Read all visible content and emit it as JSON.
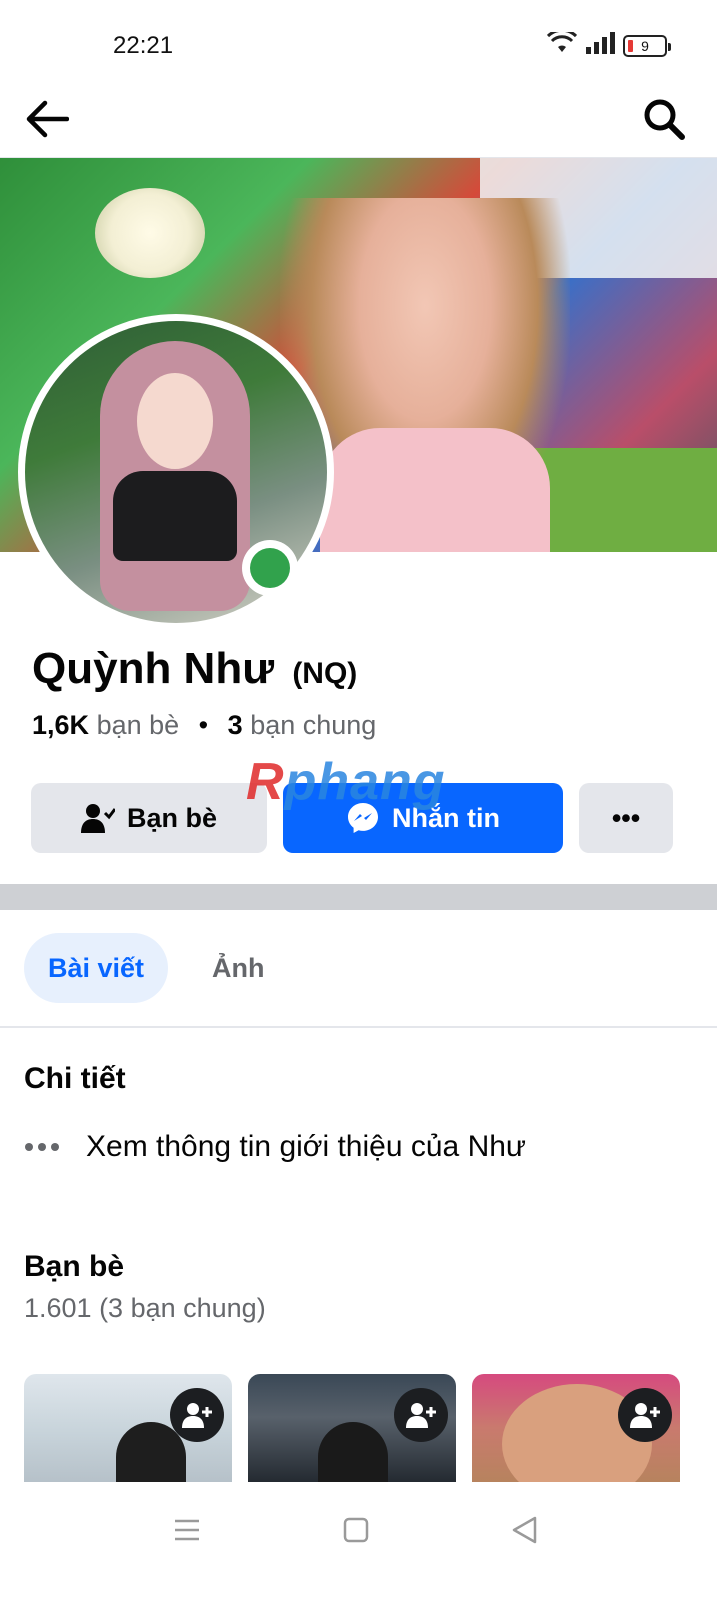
{
  "status_bar": {
    "time": "22:21",
    "battery": "9",
    "icons": [
      "wifi-icon",
      "signal-icon",
      "battery-icon"
    ]
  },
  "top_nav": {
    "back_icon": "arrow-left-icon",
    "search_icon": "search-icon"
  },
  "profile": {
    "name": "Quỳnh Như",
    "nickname": "(NQ)",
    "friends_count": "1,6K",
    "friends_label": "bạn bè",
    "mutual_count": "3",
    "mutual_label": "bạn chung",
    "online": true
  },
  "actions": {
    "friends_label": "Bạn bè",
    "message_label": "Nhắn tin",
    "more_label": "•••"
  },
  "watermark": {
    "part1": "R",
    "part2": "phang"
  },
  "tabs": [
    {
      "label": "Bài viết",
      "active": true
    },
    {
      "label": "Ảnh",
      "active": false
    }
  ],
  "details": {
    "title": "Chi tiết",
    "about_text": "Xem thông tin giới thiệu của Như"
  },
  "friends_section": {
    "title": "Bạn bè",
    "subtitle": "1.601 (3 bạn chung)"
  },
  "colors": {
    "primary": "#0866ff",
    "button_gray": "#e4e6eb",
    "online": "#31a24c",
    "tab_active_bg": "#e7f0fd"
  }
}
